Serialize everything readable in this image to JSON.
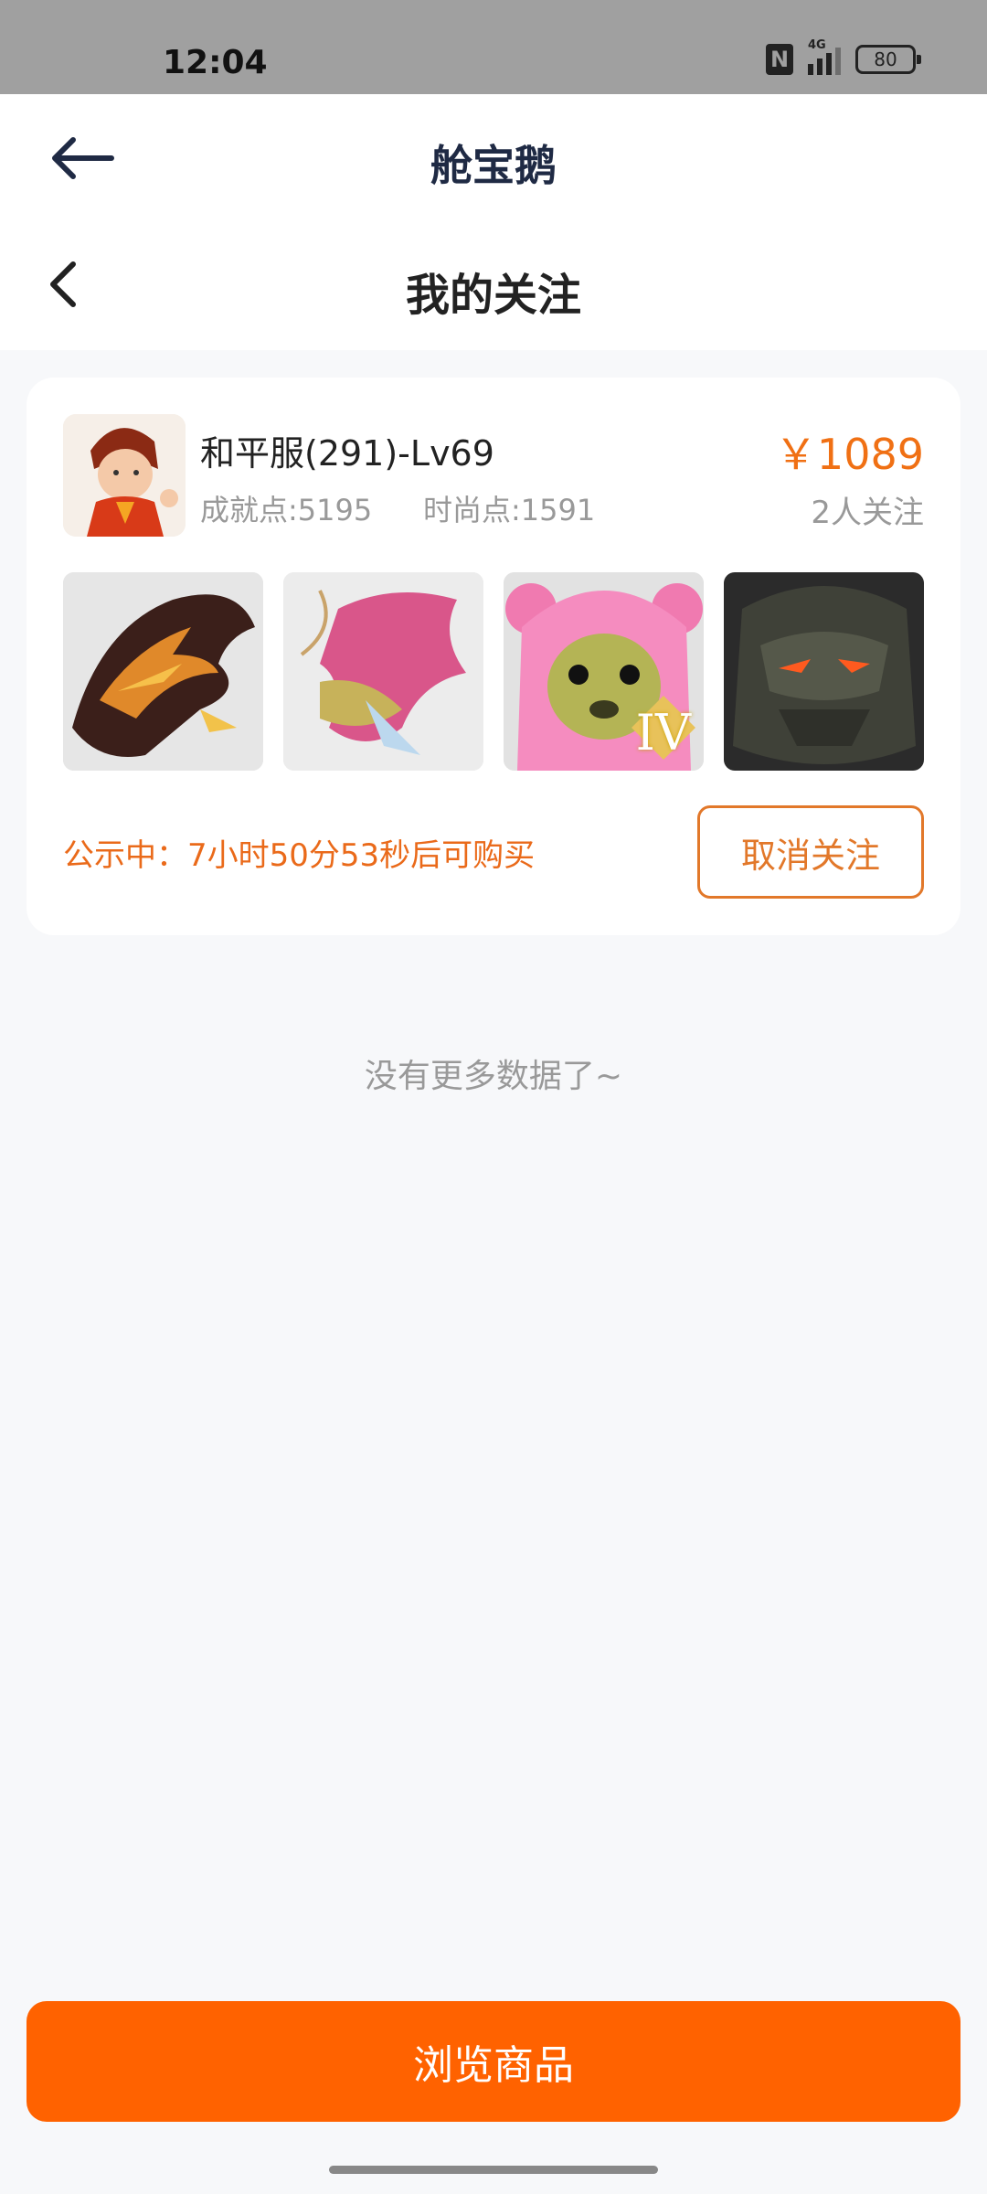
{
  "status_bar": {
    "time": "12:04",
    "network": "4G",
    "battery": "80"
  },
  "app_header": {
    "title": "舱宝鹅"
  },
  "page_header": {
    "title": "我的关注"
  },
  "card": {
    "title": "和平服(291)-Lv69",
    "achievement": "成就点:5195",
    "fashion": "时尚点:1591",
    "price": "￥1089",
    "followers": "2人关注",
    "thumb_badge": "IV",
    "notice": "公示中：7小时50分53秒后可购买",
    "unfollow_label": "取消关注"
  },
  "no_more_text": "没有更多数据了~",
  "browse_label": "浏览商品",
  "colors": {
    "accent": "#ff6200",
    "price": "#f07014"
  }
}
